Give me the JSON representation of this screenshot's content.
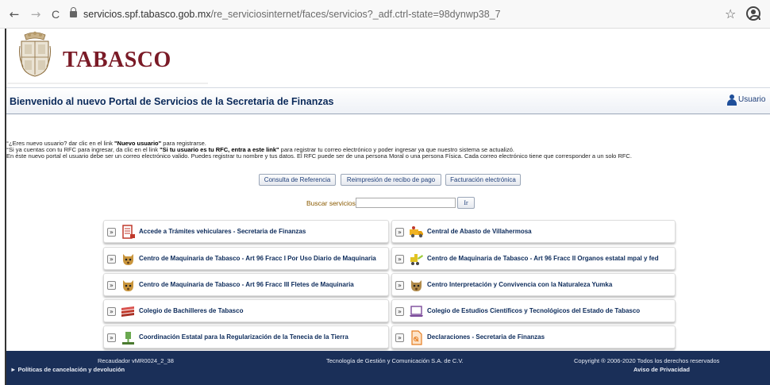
{
  "browser": {
    "back": "←",
    "forward": "→",
    "reload": "C",
    "url_host": "servicios.spf.tabasco.gob.mx",
    "url_path": "/re_serviciosinternet/faces/servicios?_adf.ctrl-state=98dynwp38_7",
    "bookmark_icon": "star-icon",
    "profile_icon": "account-icon"
  },
  "brand": {
    "name": "TABASCO",
    "color": "#7a1a26",
    "seal_icon": "state-seal"
  },
  "header": {
    "title": "Bienvenido al nuevo Portal de Servicios de la Secretaria de Finanzas",
    "user_label": "Usuario"
  },
  "info": {
    "line1_pre": "°¿Eres nuevo usuario? dar clic en el link ",
    "line1_link": "\"Nuevo usuario\"",
    "line1_post": " para registrarse.",
    "line2_pre": "°Si ya cuentas con tu RFC para ingresar, da clic en el link ",
    "line2_link": "\"Si tu usuario es tu RFC, entra a este link\"",
    "line2_post": " para registrar tu correo electrónico y poder ingresar ya que nuestro sistema se actualizó.",
    "line3": "En éste nuevo portal el usuario debe ser un correo electrónico valido. Puedes registrar tu nombre y tus datos. El RFC puede ser de una persona Moral o una persona Física. Cada correo electrónico tiene que corresponder a un solo RFC."
  },
  "buttons": {
    "consulta": "Consulta de Referencia",
    "reimpresion": "Reimpresión de recibo de pago",
    "facturacion": "Facturación electrónica"
  },
  "search": {
    "label": "Buscar servicios",
    "value": "",
    "go": "Ir"
  },
  "services": [
    {
      "label": "Accede a Trámites vehiculares - Secretaria de Finanzas",
      "icon": "vehicle-form-icon"
    },
    {
      "label": "Central de Abasto de Villahermosa",
      "icon": "delivery-truck-icon"
    },
    {
      "label": "Centro de Maquinaria de Tabasco - Art 96 Fracc I Por Uso Diario de Maquinaria",
      "icon": "jaguar-icon"
    },
    {
      "label": "Centro de Maquinaria de Tabasco - Art 96 Fracc II Organos estatal mpal y fed",
      "icon": "machinery-icon"
    },
    {
      "label": "Centro de Maquinaria de Tabasco - Art 96 Fracc III Fletes de Maquinaria",
      "icon": "jaguar-icon"
    },
    {
      "label": "Centro Interpretación y Convivencia con la Naturaleza Yumka",
      "icon": "jaguar-icon"
    },
    {
      "label": "Colegio de Bachilleres de Tabasco",
      "icon": "books-icon"
    },
    {
      "label": "Colegio de Estudios Científicos y Tecnológicos del Estado de Tabasco",
      "icon": "laptop-icon"
    },
    {
      "label": "Coordinación Estatal para la Regularización de la Tenecia de la Tierra",
      "icon": "land-marker-icon"
    },
    {
      "label": "Declaraciones - Secretaria de Finanzas",
      "icon": "document-icon"
    }
  ],
  "footer": {
    "version": "Recaudador vMR0024_2_38",
    "policies": "► Políticas de cancelación y devolución",
    "company": "Tecnología de Gestión y Comunicación S.A. de C.V.",
    "copyright": "Copyright ® 2006-2020 Todos los derechos reservados",
    "privacy": "Aviso de Privacidad"
  },
  "colors": {
    "navy": "#0b2a5a",
    "footer_bg": "#1a2f58",
    "search_label": "#8a5a00"
  }
}
